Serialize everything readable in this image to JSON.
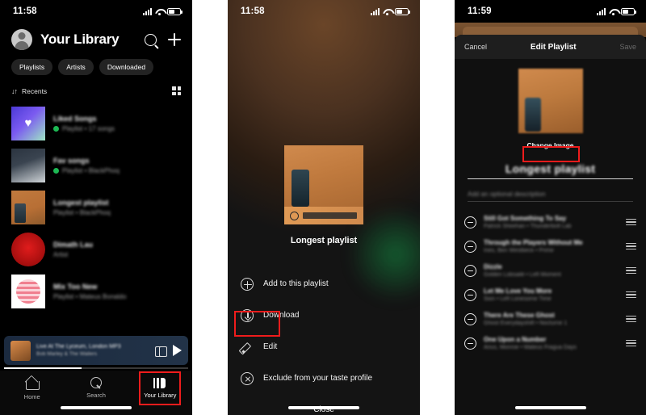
{
  "panels": {
    "library": {
      "status": {
        "time": "11:58"
      },
      "header": {
        "title": "Your Library",
        "search_icon": "search-icon",
        "add_icon": "plus-icon",
        "avatar": "avatar"
      },
      "chips": [
        "Playlists",
        "Artists",
        "Downloaded"
      ],
      "sort": {
        "label": "Recents",
        "icon": "sort-arrows-icon",
        "view_icon": "grid-view-icon"
      },
      "items": [
        {
          "name": "Liked Songs",
          "sub": "Playlist • 17 songs",
          "downloaded": true,
          "art": "art-liked"
        },
        {
          "name": "Fav songs",
          "sub": "Playlist • BlackPhoq",
          "downloaded": true,
          "art": "art-fav"
        },
        {
          "name": "Longest playlist",
          "sub": "Playlist • BlackPhoq",
          "downloaded": false,
          "art": "art-long"
        },
        {
          "name": "Dimath Lau",
          "sub": "Artist",
          "downloaded": false,
          "art": "art-red"
        },
        {
          "name": "Mix Too New",
          "sub": "Playlist • Mateus Bonaldo",
          "downloaded": false,
          "art": "art-white"
        }
      ],
      "player": {
        "title": "Live At The Lyceum, London MP3",
        "artist": "Bob Marley & The Wailers",
        "cast_icon": "cast-devices-icon",
        "play_icon": "play-icon"
      },
      "tabs": [
        {
          "label": "Home",
          "icon": "home-icon",
          "active": false
        },
        {
          "label": "Search",
          "icon": "search-icon",
          "active": false
        },
        {
          "label": "Your Library",
          "icon": "library-icon",
          "active": true
        }
      ]
    },
    "context_menu": {
      "status": {
        "time": "11:58"
      },
      "playlist_title": "Longest playlist",
      "items": [
        {
          "label": "Add to this playlist",
          "icon": "plus-circle-icon"
        },
        {
          "label": "Download",
          "icon": "download-circle-icon"
        },
        {
          "label": "Edit",
          "icon": "pencil-icon"
        },
        {
          "label": "Exclude from your taste profile",
          "icon": "x-circle-icon"
        }
      ],
      "close_label": "Close"
    },
    "edit_playlist": {
      "status": {
        "time": "11:59"
      },
      "navbar": {
        "cancel": "Cancel",
        "title": "Edit Playlist",
        "save": "Save"
      },
      "change_image": "Change Image",
      "name_value": "Longest playlist",
      "description_placeholder": "Add an optional description",
      "tracks": [
        {
          "name": "Still Got Something To Say",
          "sub": "Patrick Sheehan • Thunderbolt Lab"
        },
        {
          "name": "Through the Players Without Me",
          "sub": "Ines, Ben Westbeck • Prime"
        },
        {
          "name": "Dizzle",
          "sub": "Golden Lobsailé • Left Moment"
        },
        {
          "name": "Let Me Love You More",
          "sub": "Sion • Left Lonesome Time"
        },
        {
          "name": "There Are These Ghost",
          "sub": "Ghost Everydayshift • Nocturne 1"
        },
        {
          "name": "One Upon a Number",
          "sub": "Arius, Monroe • Mateus Fragua Days"
        }
      ],
      "remove_icon": "minus-circle-icon",
      "drag_icon": "drag-handle-icon"
    }
  },
  "annotations": {
    "accent_color": "#ef1c1c",
    "highlights": [
      "Your Library",
      "Edit",
      "Change Image"
    ]
  }
}
